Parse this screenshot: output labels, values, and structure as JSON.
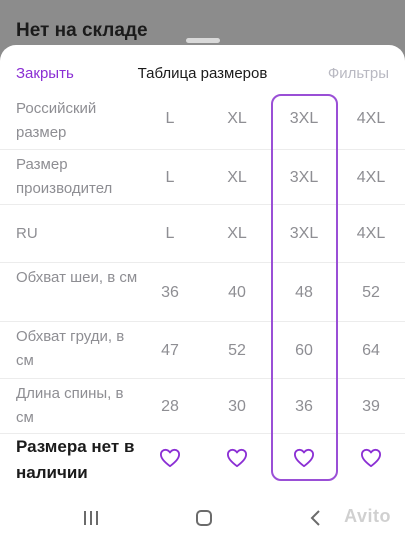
{
  "background": {
    "title": "Нет на складе"
  },
  "sheet": {
    "close_label": "Закрыть",
    "title": "Таблица размеров",
    "filters_label": "Фильтры",
    "highlight_color": "#9a4fd6",
    "accent_color": "#8b2fd4"
  },
  "table": {
    "rows": [
      {
        "label": "Российский размер",
        "cells": [
          "L",
          "XL",
          "3XL",
          "4XL"
        ]
      },
      {
        "label": "Размер производител",
        "cells": [
          "L",
          "XL",
          "3XL",
          "4XL"
        ]
      },
      {
        "label": "RU",
        "cells": [
          "L",
          "XL",
          "3XL",
          "4XL"
        ]
      },
      {
        "label": "Обхват шеи, в см",
        "cells": [
          "36",
          "40",
          "48",
          "52"
        ]
      },
      {
        "label": "Обхват груди, в см",
        "cells": [
          "47",
          "52",
          "60",
          "64"
        ]
      },
      {
        "label": "Длина спины, в см",
        "cells": [
          "28",
          "30",
          "36",
          "39"
        ]
      }
    ],
    "availability_label": "Размера нет в наличии",
    "availability_icon": "heart-outline-icon",
    "selected_column": "3XL"
  },
  "navbar": {
    "icons": [
      "recent-apps-icon",
      "home-icon",
      "back-icon"
    ]
  },
  "watermark": "Avito"
}
